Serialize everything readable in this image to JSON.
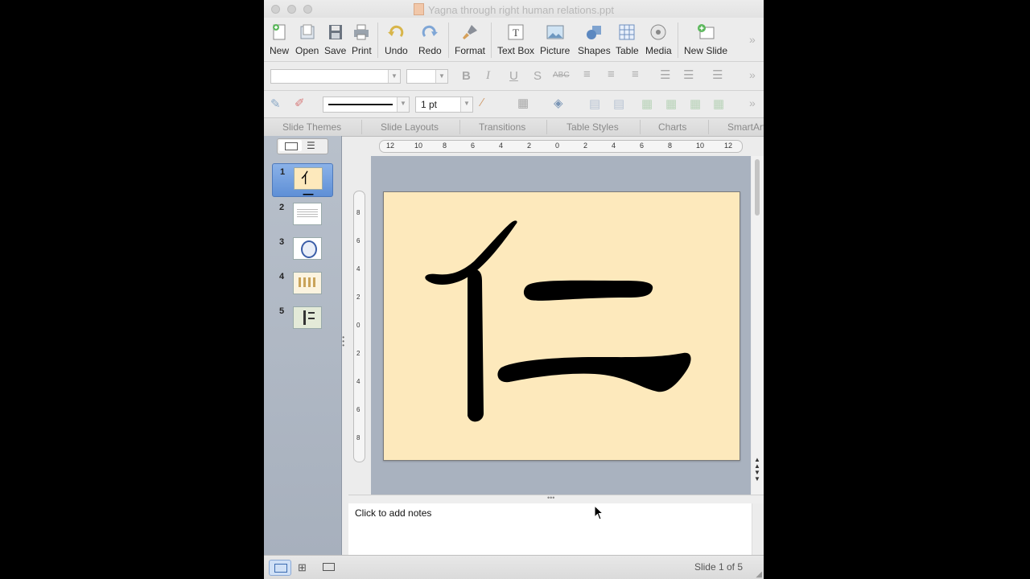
{
  "window": {
    "title": "Yagna through right human relations.ppt"
  },
  "toolbar": {
    "new": "New",
    "open": "Open",
    "save": "Save",
    "print": "Print",
    "undo": "Undo",
    "redo": "Redo",
    "format": "Format",
    "text_box": "Text Box",
    "picture": "Picture",
    "shapes": "Shapes",
    "table": "Table",
    "media": "Media",
    "new_slide": "New Slide"
  },
  "format_bar": {
    "font_name": "",
    "font_size": "",
    "line_weight": "1 pt"
  },
  "ribbon_tabs": [
    "Slide Themes",
    "Slide Layouts",
    "Transitions",
    "Table Styles",
    "Charts",
    "SmartArt"
  ],
  "slides": [
    {
      "num": "1",
      "label": "亻二"
    },
    {
      "num": "2",
      "label": ""
    },
    {
      "num": "3",
      "label": ""
    },
    {
      "num": "4",
      "label": ""
    },
    {
      "num": "5",
      "label": ""
    }
  ],
  "ruler": {
    "h_ticks": [
      "12",
      "10",
      "8",
      "6",
      "4",
      "2",
      "0",
      "2",
      "4",
      "6",
      "8",
      "10",
      "12"
    ],
    "v_ticks": [
      "8",
      "6",
      "4",
      "2",
      "0",
      "2",
      "4",
      "6",
      "8"
    ]
  },
  "slide": {
    "background": "#fde9bc",
    "glyph": "仁"
  },
  "notes": {
    "placeholder": "Click to add notes"
  },
  "status": {
    "slide_count": "Slide 1 of 5"
  }
}
